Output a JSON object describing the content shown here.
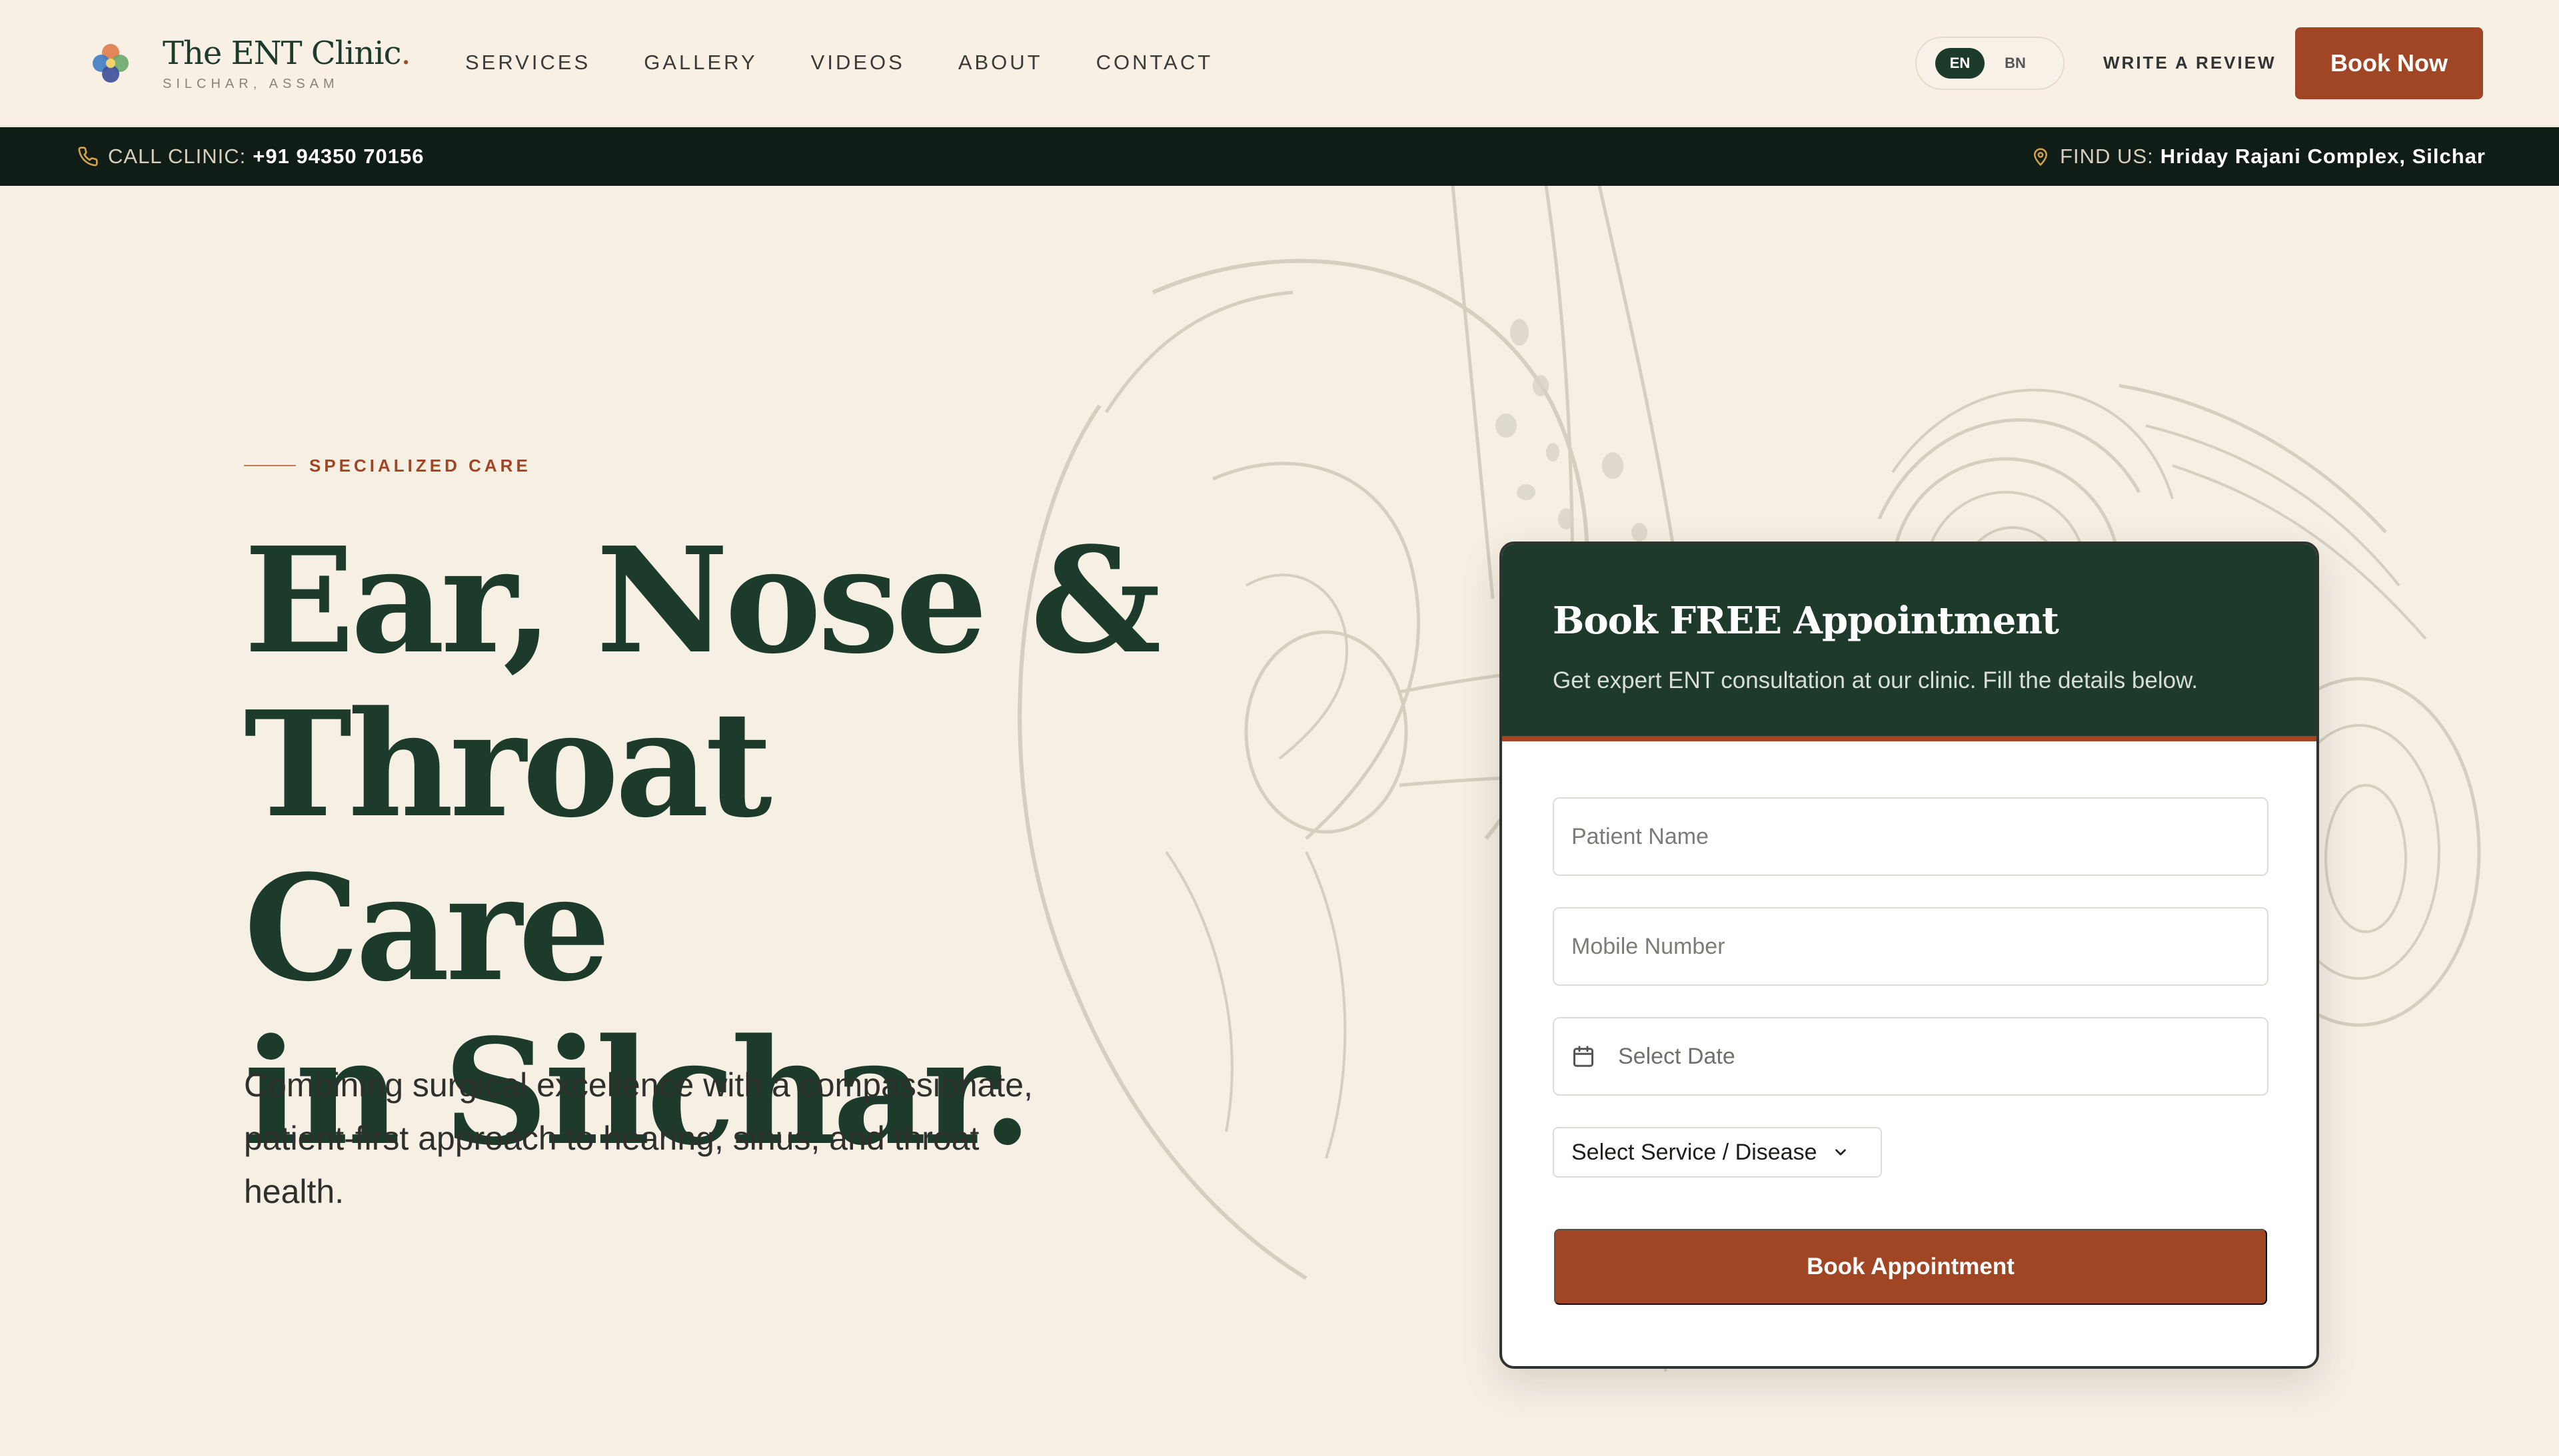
{
  "brand": {
    "name": "The ENT Clinic",
    "dot": ".",
    "location": "SILCHAR, ASSAM"
  },
  "nav": {
    "items": [
      {
        "label": "SERVICES"
      },
      {
        "label": "GALLERY"
      },
      {
        "label": "VIDEOS"
      },
      {
        "label": "ABOUT"
      },
      {
        "label": "CONTACT"
      }
    ]
  },
  "header": {
    "lang_en": "EN",
    "lang_bn": "BN",
    "write_review": "WRITE A REVIEW",
    "book_now": "Book Now"
  },
  "infobar": {
    "call_label": "CALL CLINIC:",
    "call_number": "+91 94350 70156",
    "find_label": "FIND US:",
    "find_value": "Hriday Rajani Complex, Silchar"
  },
  "hero": {
    "eyebrow": "SPECIALIZED CARE",
    "title_line1": "Ear, Nose &",
    "title_line2": "Throat Care",
    "title_line3": "in Silchar.",
    "description": "Combining surgical excellence with a compassionate, patient-first approach to hearing, sinus, and throat health."
  },
  "booking": {
    "title": "Book FREE Appointment",
    "subtitle": "Get expert ENT consultation at our clinic. Fill the details below.",
    "name_placeholder": "Patient Name",
    "mobile_placeholder": "Mobile Number",
    "date_placeholder": "Select Date",
    "service_select": "Select Service / Disease",
    "submit": "Book Appointment"
  },
  "colors": {
    "primary_green": "#1c3b2b",
    "accent_rust": "#a14624",
    "background": "#f7f0e6",
    "infobar": "#0f1d16"
  }
}
